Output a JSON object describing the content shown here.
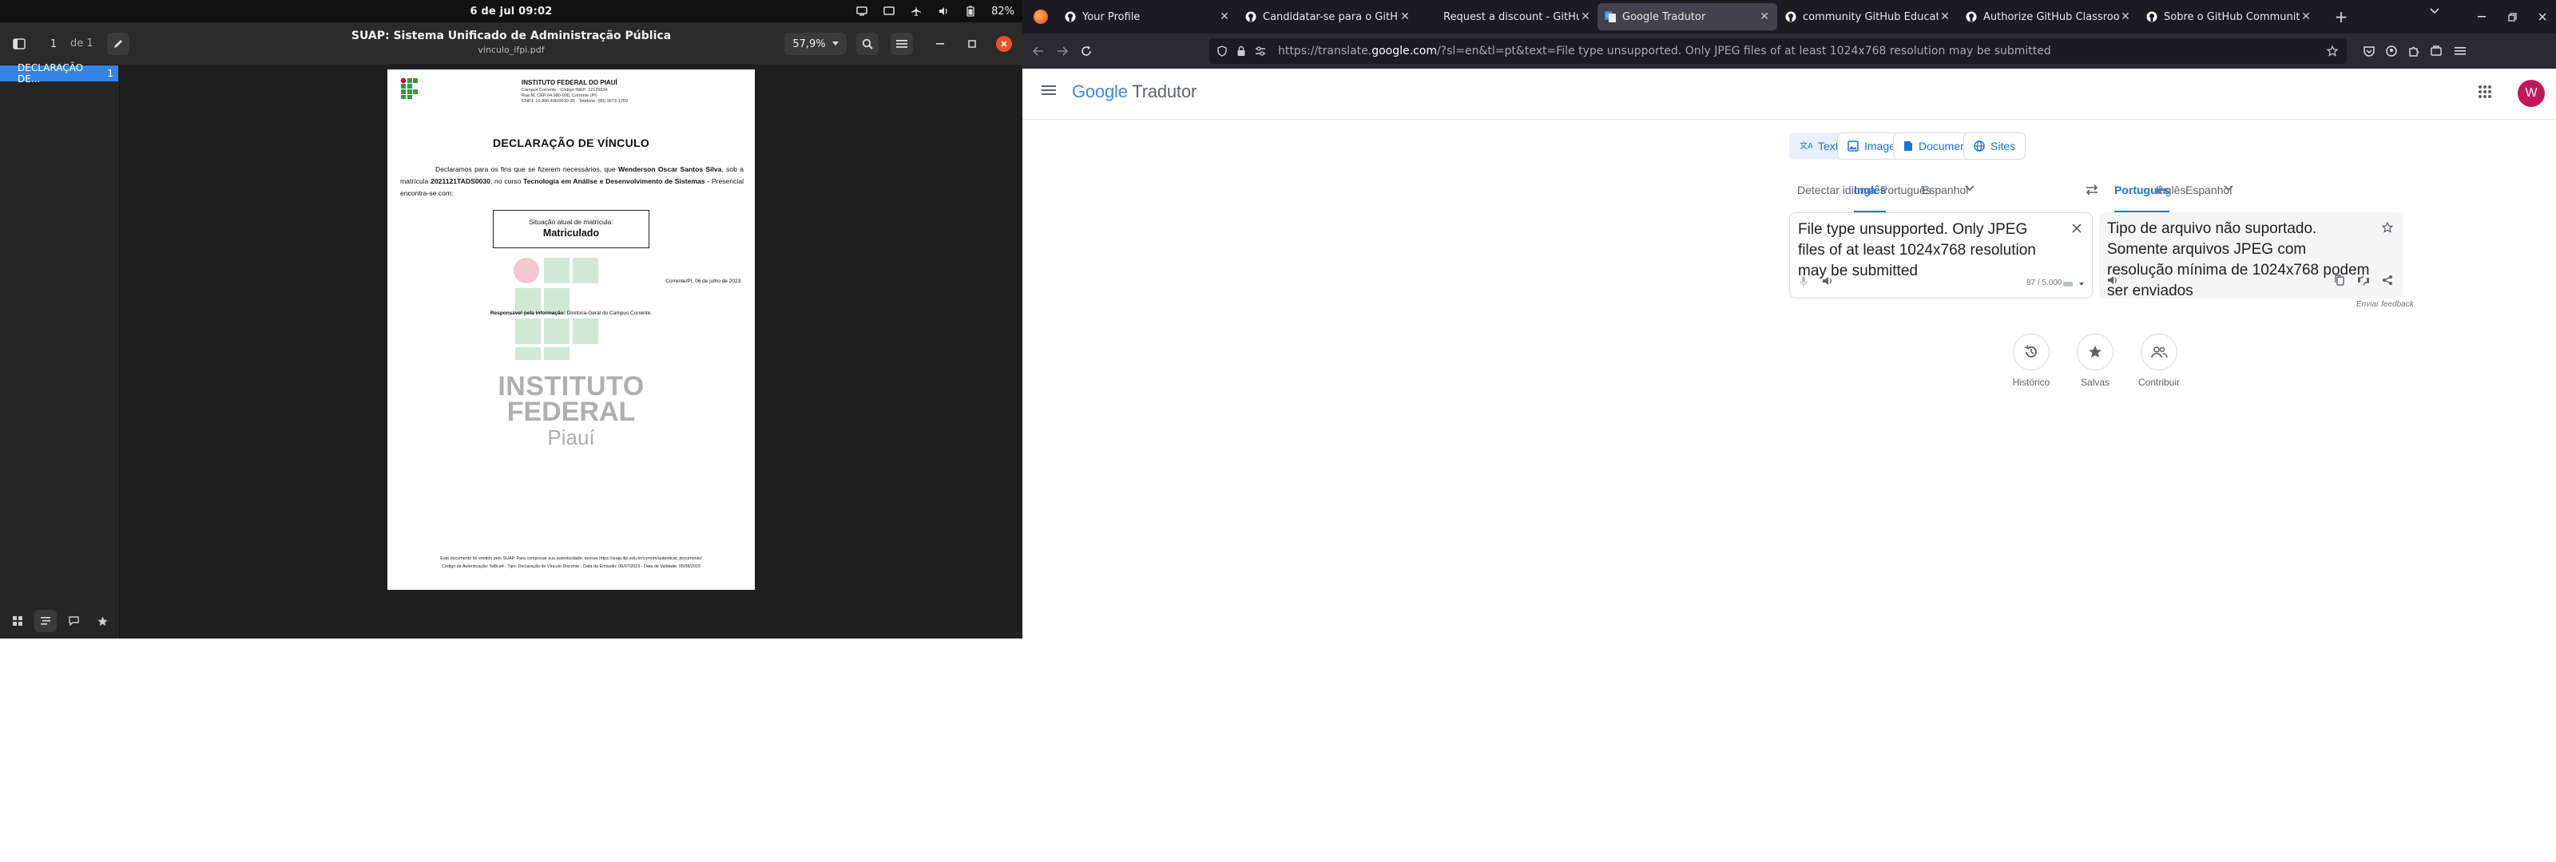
{
  "system": {
    "clock": "6 de jul  09:02",
    "battery": "82%"
  },
  "pdf": {
    "page_current": "1",
    "page_of": "de 1",
    "title": "SUAP: Sistema Unificado de Administração Pública",
    "filename": "vinculo_ifpi.pdf",
    "zoom": "57,9%",
    "sidebar_item": "DECLARAÇÃO DE...",
    "sidebar_item_page": "1",
    "document": {
      "institution": "INSTITUTO FEDERAL DO PIAUÍ",
      "inst_line1": "Campus Corrente · Código INEP: 22125634",
      "inst_line2": "Rua M, CEP 64.980-000, Corrente (PI)",
      "inst_line3": "CNPJ: 10.806.496/0010-30 · Telefone: (89) 3573-1259",
      "decl_title": "DECLARAÇÃO DE VÍNCULO",
      "body_1": "Declaramos para os fins que se fizerem necessários, que ",
      "student": "Wenderson Oscar Santos Silva",
      "body_2": ", sob a matrícula ",
      "matricula": "2021121TADS0030",
      "body_3": ", no curso ",
      "course": "Tecnologia em Análise e Desenvolvimento de Sistemas",
      "body_4": " - Presencial encontra-se com:",
      "status_label": "Situação atual de matrícula:",
      "status_value": "Matriculado",
      "place_date": "Corrente/PI, 06 de julho de 2023.",
      "responsible_label": "Responsável pela informação:",
      "responsible_value": "Diretoria-Geral do Campus Corrente.",
      "wm_1": "INSTITUTO",
      "wm_2": "FEDERAL",
      "wm_3": "Piauí",
      "footer_1": "Este documento foi emitido pelo SUAP. Para comprovar sua autenticidade, acesse https://suap.ifpi.edu.br/comum/autenticar_documento/",
      "footer_2": "Código de Autenticação: 5d8ca4 - Tipo: Declaração de Vínculo Discente - Data da Emissão: 06/07/2023 - Data de Validade: 05/08/2023"
    }
  },
  "browser": {
    "tabs": [
      {
        "title": "Your Profile",
        "icon": "github-icon"
      },
      {
        "title": "Candidatar-se para o GitHub",
        "icon": "github-icon"
      },
      {
        "title": "Request a discount - GitHub",
        "icon": "none"
      },
      {
        "title": "Google Tradutor",
        "icon": "translate-icon"
      },
      {
        "title": "community GitHub Educatio",
        "icon": "github-icon"
      },
      {
        "title": "Authorize GitHub Classroom",
        "icon": "github-icon"
      },
      {
        "title": "Sobre o GitHub Community",
        "icon": "github-icon"
      }
    ],
    "url_prefix": "https://translate.",
    "url_host": "google.com",
    "url_rest": "/?sl=en&tl=pt&text=File type unsupported. Only JPEG files of at least 1024x768 resolution may be submitted"
  },
  "translate": {
    "logo_google": "Google",
    "logo_product": "Tradutor",
    "avatar_letter": "W",
    "modes": [
      "Texto",
      "Imagens",
      "Documentos",
      "Sites"
    ],
    "source_langs": [
      "Detectar idioma",
      "Inglês",
      "Português",
      "Espanhol"
    ],
    "target_langs": [
      "Português",
      "Inglês",
      "Espanhol"
    ],
    "source_text": "File type unsupported. Only JPEG files of at least 1024x768 resolution may be submitted",
    "target_text": "Tipo de arquivo não suportado. Somente arquivos JPEG com resolução mínima de 1024x768 podem ser enviados",
    "char_count": "87 / 5.000",
    "feedback": "Enviar feedback",
    "actions": [
      "Histórico",
      "Salvas",
      "Contribuir"
    ],
    "colors": {
      "accent": "#1a73e8",
      "active_bg": "#e8f0fe"
    }
  }
}
